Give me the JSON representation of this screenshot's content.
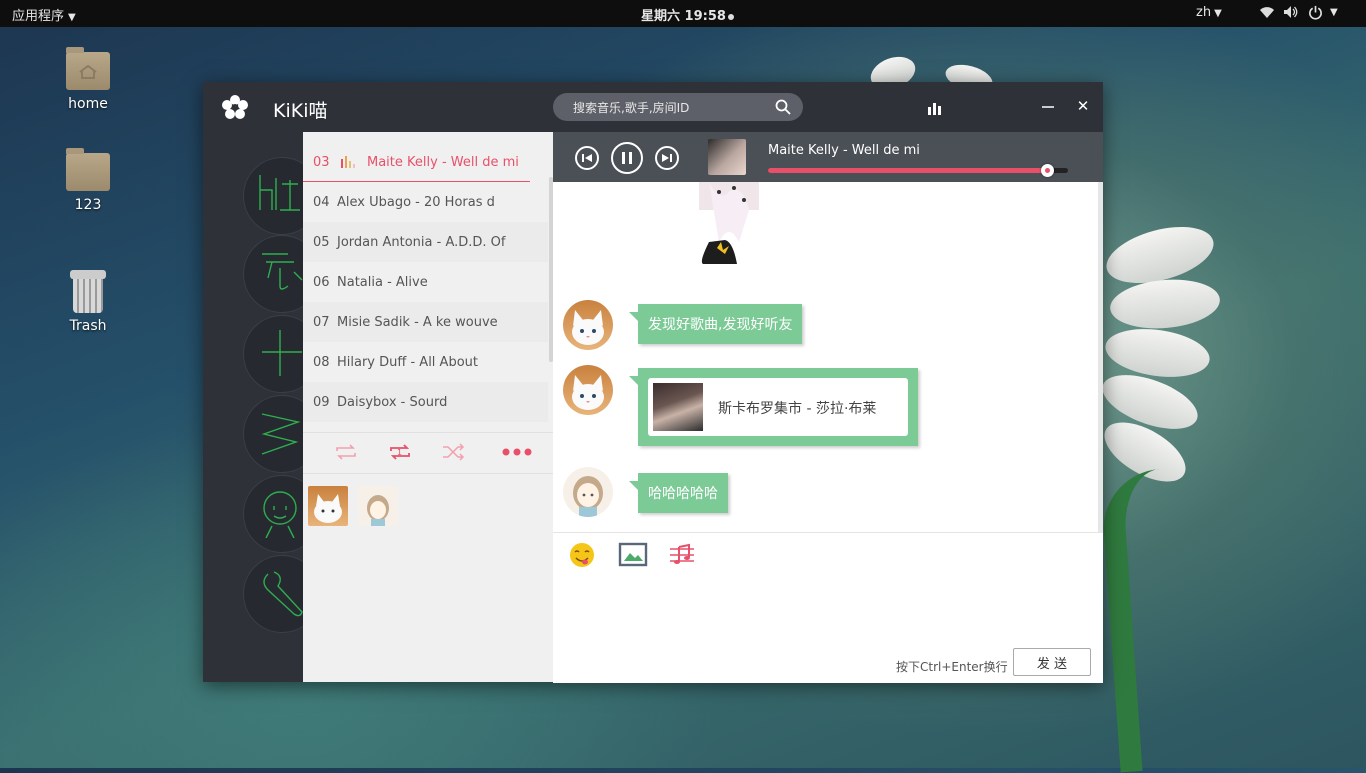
{
  "topbar": {
    "apps_menu": "应用程序",
    "clock": "星期六 19:58",
    "language": "zh"
  },
  "desktop": {
    "icons": [
      {
        "label": "home"
      },
      {
        "label": "123"
      },
      {
        "label": "Trash"
      }
    ]
  },
  "app": {
    "title": "KiKi喵",
    "search_placeholder": "搜索音乐,歌手,房间ID",
    "accent_color": "#e8506a",
    "bubble_color": "#7ccb97"
  },
  "playlist": {
    "items": [
      {
        "num": "03",
        "title": "Maite Kelly - Well de mi",
        "active": true
      },
      {
        "num": "04",
        "title": "Alex Ubago - 20 Horas d"
      },
      {
        "num": "05",
        "title": "Jordan Antonia - A.D.D. Of"
      },
      {
        "num": "06",
        "title": "Natalia - Alive"
      },
      {
        "num": "07",
        "title": "Misie Sadik - A ke wouve"
      },
      {
        "num": "08",
        "title": "Hilary Duff - All About"
      },
      {
        "num": "09",
        "title": "Daisybox - Sourd"
      }
    ]
  },
  "player": {
    "now_playing": "Maite Kelly - Well de mi",
    "progress": 0.93
  },
  "chat": {
    "messages": [
      {
        "type": "text",
        "text": "发现好歌曲,发现好听友"
      },
      {
        "type": "song",
        "text": "斯卡布罗集市 - 莎拉·布莱"
      },
      {
        "type": "text",
        "text": "哈哈哈哈哈"
      }
    ]
  },
  "compose": {
    "hint": "按下Ctrl+Enter换行",
    "send_label": "发 送"
  }
}
